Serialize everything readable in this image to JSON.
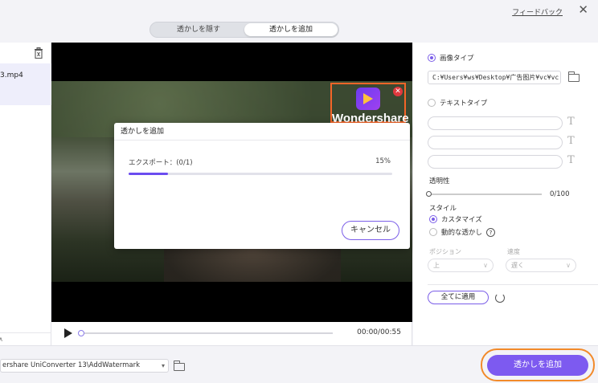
{
  "header": {
    "feedback_label": "フィードバック",
    "close_symbol": "✕",
    "tabs": [
      {
        "label": "透かしを隠す",
        "active": false
      },
      {
        "label": "透かしを追加",
        "active": true
      }
    ]
  },
  "file_panel": {
    "file_name": "3.mp4",
    "scroll_symbol": "∧"
  },
  "preview": {
    "watermark_text": "Wondershare",
    "remove_symbol": "✕",
    "highlight_color": "#f46528"
  },
  "dialog": {
    "title": "透かしを追加",
    "export_label": "エクスポート：(0/1)",
    "progress_text": "15%",
    "progress": 0.15,
    "cancel_label": "キャンセル"
  },
  "player": {
    "time_text": "00:00/00:55",
    "position": 0.0
  },
  "settings": {
    "image_type_label": "画像タイプ",
    "image_path": "C:¥Users¥ws¥Desktop¥广告图片¥vc¥vc lo",
    "text_type_label": "テキストタイプ",
    "text_icon": "T",
    "opacity_label": "透明性",
    "opacity_value": "0/100",
    "opacity": 0,
    "style_label": "スタイル",
    "style_custom_label": "カスタマイズ",
    "style_dynamic_label": "動的な透かし",
    "help_symbol": "?",
    "position_label": "ポジション",
    "position_value": "上",
    "speed_label": "速度",
    "speed_value": "遅く",
    "chevron": "∨",
    "apply_all_label": "全てに適用"
  },
  "bottom": {
    "output_path": "ershare UniConverter 13\\AddWatermark",
    "chevron": "▾",
    "add_button_label": "透かしを追加"
  },
  "colors": {
    "accent": "#7d5af0",
    "highlight": "#f28a2a",
    "remove": "#e0383e"
  }
}
